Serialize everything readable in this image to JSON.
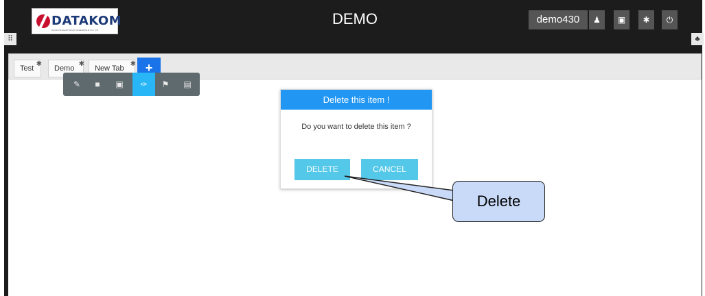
{
  "header": {
    "logo_text": "DATAKOM",
    "logo_tagline": "DATAKOM ELEKTRONIK MÜHENDİSLİK LTD. ŞTİ.",
    "title": "DEMO",
    "user_name": "demo430",
    "icons": [
      "user-icon",
      "save-icon",
      "settings-icon",
      "power-icon"
    ]
  },
  "side": {
    "apps_icon": "⠿",
    "tree_icon": "♣"
  },
  "tabs": [
    {
      "label": "Test"
    },
    {
      "label": "Demo"
    },
    {
      "label": "New Tab"
    }
  ],
  "add_tab_label": "+",
  "toolbar": {
    "tools": [
      "edit-icon",
      "trash-icon",
      "image-icon",
      "brush-icon",
      "flag-icon",
      "chart-icon"
    ],
    "active_tool": "brush-icon"
  },
  "dialog": {
    "title": "Delete this item !",
    "message": "Do you want to delete this item ?",
    "delete_label": "DELETE",
    "cancel_label": "CANCEL"
  },
  "callout": {
    "text": "Delete"
  },
  "colors": {
    "frame": "#1c1c1c",
    "accent_blue": "#2196f3",
    "button_cyan": "#54c8e8",
    "add_tab_blue": "#1a73e8",
    "active_tool": "#29b6f6",
    "callout_fill": "#c9daf8"
  }
}
